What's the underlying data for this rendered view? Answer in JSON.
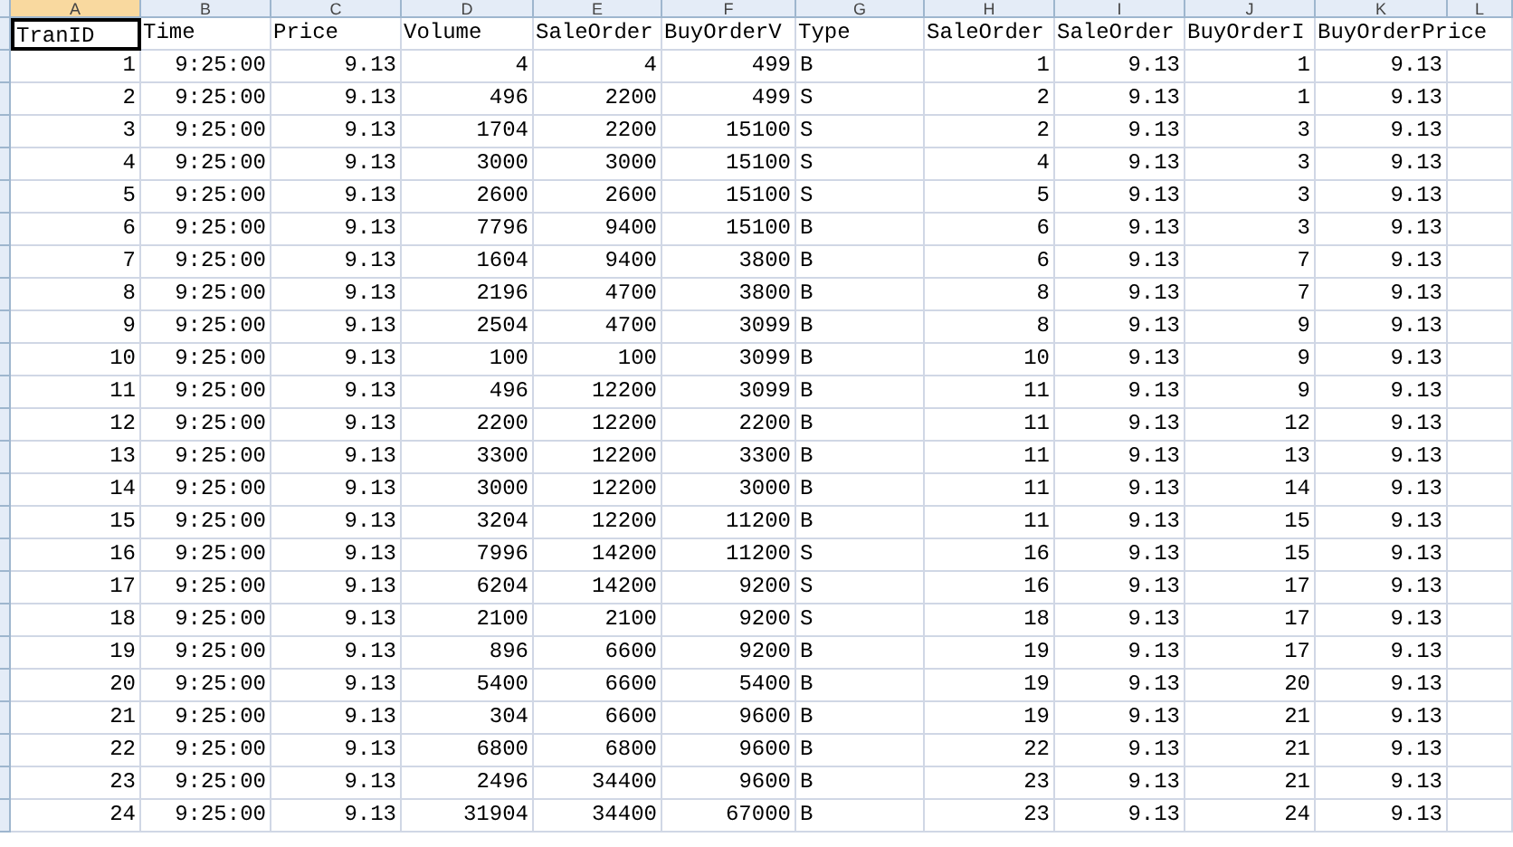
{
  "columns": [
    {
      "letter": "A",
      "header": "TranID",
      "selected": true
    },
    {
      "letter": "B",
      "header": "Time",
      "selected": false
    },
    {
      "letter": "C",
      "header": "Price",
      "selected": false
    },
    {
      "letter": "D",
      "header": "Volume",
      "selected": false
    },
    {
      "letter": "E",
      "header": "SaleOrder",
      "selected": false
    },
    {
      "letter": "F",
      "header": "BuyOrderV",
      "selected": false
    },
    {
      "letter": "G",
      "header": "Type",
      "selected": false
    },
    {
      "letter": "H",
      "header": "SaleOrder",
      "selected": false
    },
    {
      "letter": "I",
      "header": "SaleOrder",
      "selected": false
    },
    {
      "letter": "J",
      "header": "BuyOrderI",
      "selected": false
    },
    {
      "letter": "K",
      "header": "BuyOrderPrice",
      "selected": false
    },
    {
      "letter": "L",
      "selected": false
    }
  ],
  "rows": [
    [
      "1",
      "9:25:00",
      "9.13",
      "4",
      "4",
      "499",
      "B",
      "1",
      "9.13",
      "1",
      "9.13"
    ],
    [
      "2",
      "9:25:00",
      "9.13",
      "496",
      "2200",
      "499",
      "S",
      "2",
      "9.13",
      "1",
      "9.13"
    ],
    [
      "3",
      "9:25:00",
      "9.13",
      "1704",
      "2200",
      "15100",
      "S",
      "2",
      "9.13",
      "3",
      "9.13"
    ],
    [
      "4",
      "9:25:00",
      "9.13",
      "3000",
      "3000",
      "15100",
      "S",
      "4",
      "9.13",
      "3",
      "9.13"
    ],
    [
      "5",
      "9:25:00",
      "9.13",
      "2600",
      "2600",
      "15100",
      "S",
      "5",
      "9.13",
      "3",
      "9.13"
    ],
    [
      "6",
      "9:25:00",
      "9.13",
      "7796",
      "9400",
      "15100",
      "B",
      "6",
      "9.13",
      "3",
      "9.13"
    ],
    [
      "7",
      "9:25:00",
      "9.13",
      "1604",
      "9400",
      "3800",
      "B",
      "6",
      "9.13",
      "7",
      "9.13"
    ],
    [
      "8",
      "9:25:00",
      "9.13",
      "2196",
      "4700",
      "3800",
      "B",
      "8",
      "9.13",
      "7",
      "9.13"
    ],
    [
      "9",
      "9:25:00",
      "9.13",
      "2504",
      "4700",
      "3099",
      "B",
      "8",
      "9.13",
      "9",
      "9.13"
    ],
    [
      "10",
      "9:25:00",
      "9.13",
      "100",
      "100",
      "3099",
      "B",
      "10",
      "9.13",
      "9",
      "9.13"
    ],
    [
      "11",
      "9:25:00",
      "9.13",
      "496",
      "12200",
      "3099",
      "B",
      "11",
      "9.13",
      "9",
      "9.13"
    ],
    [
      "12",
      "9:25:00",
      "9.13",
      "2200",
      "12200",
      "2200",
      "B",
      "11",
      "9.13",
      "12",
      "9.13"
    ],
    [
      "13",
      "9:25:00",
      "9.13",
      "3300",
      "12200",
      "3300",
      "B",
      "11",
      "9.13",
      "13",
      "9.13"
    ],
    [
      "14",
      "9:25:00",
      "9.13",
      "3000",
      "12200",
      "3000",
      "B",
      "11",
      "9.13",
      "14",
      "9.13"
    ],
    [
      "15",
      "9:25:00",
      "9.13",
      "3204",
      "12200",
      "11200",
      "B",
      "11",
      "9.13",
      "15",
      "9.13"
    ],
    [
      "16",
      "9:25:00",
      "9.13",
      "7996",
      "14200",
      "11200",
      "S",
      "16",
      "9.13",
      "15",
      "9.13"
    ],
    [
      "17",
      "9:25:00",
      "9.13",
      "6204",
      "14200",
      "9200",
      "S",
      "16",
      "9.13",
      "17",
      "9.13"
    ],
    [
      "18",
      "9:25:00",
      "9.13",
      "2100",
      "2100",
      "9200",
      "S",
      "18",
      "9.13",
      "17",
      "9.13"
    ],
    [
      "19",
      "9:25:00",
      "9.13",
      "896",
      "6600",
      "9200",
      "B",
      "19",
      "9.13",
      "17",
      "9.13"
    ],
    [
      "20",
      "9:25:00",
      "9.13",
      "5400",
      "6600",
      "5400",
      "B",
      "19",
      "9.13",
      "20",
      "9.13"
    ],
    [
      "21",
      "9:25:00",
      "9.13",
      "304",
      "6600",
      "9600",
      "B",
      "19",
      "9.13",
      "21",
      "9.13"
    ],
    [
      "22",
      "9:25:00",
      "9.13",
      "6800",
      "6800",
      "9600",
      "B",
      "22",
      "9.13",
      "21",
      "9.13"
    ],
    [
      "23",
      "9:25:00",
      "9.13",
      "2496",
      "34400",
      "9600",
      "B",
      "23",
      "9.13",
      "21",
      "9.13"
    ],
    [
      "24",
      "9:25:00",
      "9.13",
      "31904",
      "34400",
      "67000",
      "B",
      "23",
      "9.13",
      "24",
      "9.13"
    ]
  ]
}
